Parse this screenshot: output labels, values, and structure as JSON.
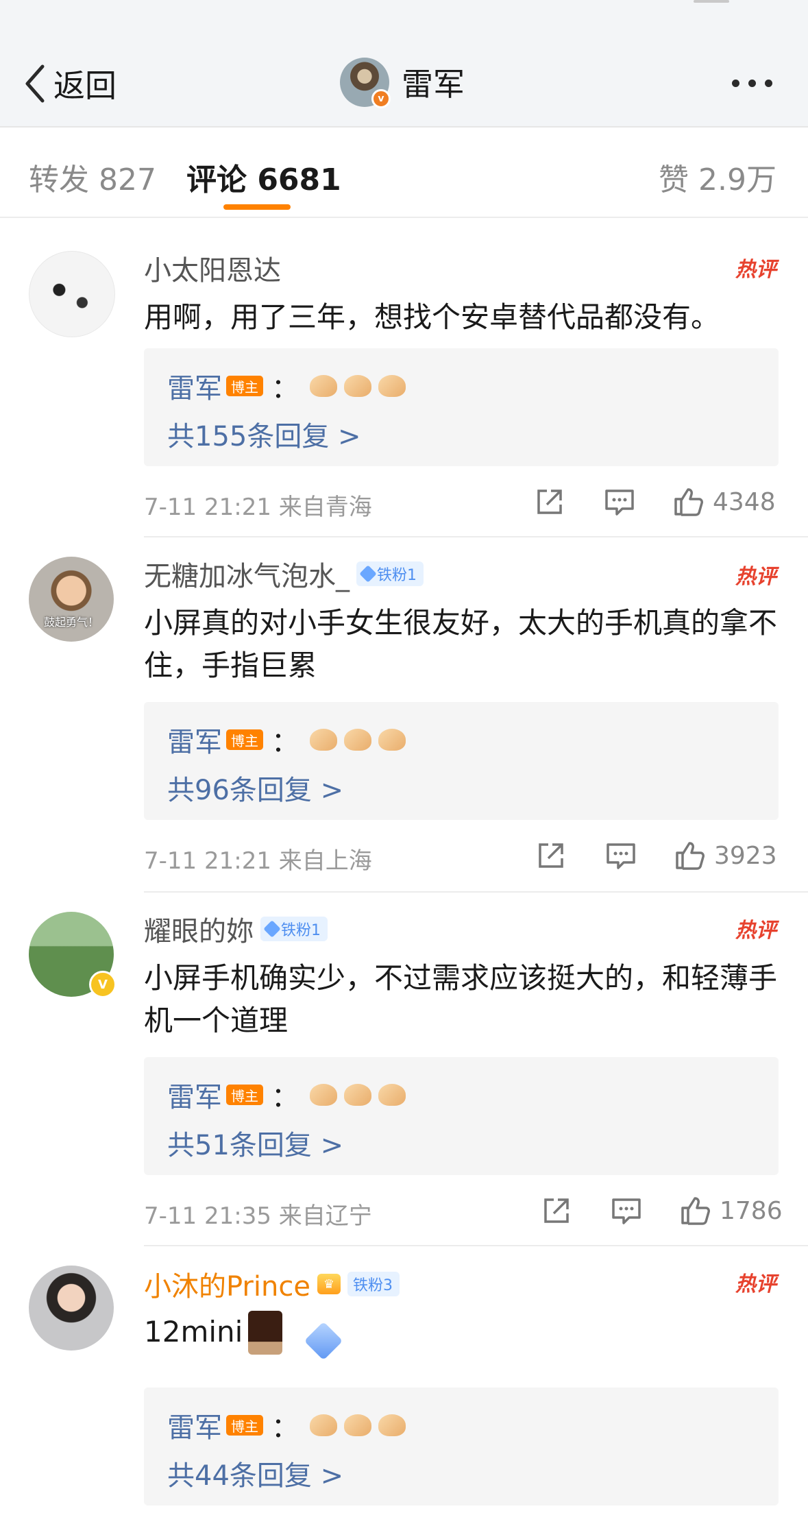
{
  "nav": {
    "back_label": "返回",
    "title": "雷军",
    "verified_mark": "v"
  },
  "tabs": {
    "repost": "转发 827",
    "comments": "评论 6681",
    "likes": "赞 2.9万"
  },
  "colors": {
    "accent": "#ff8200",
    "link_blue": "#4d6fa5",
    "hot": "#e7422e"
  },
  "comments": [
    {
      "user": "小太阳恩达",
      "hot_tag": "热评",
      "text": "用啊，用了三年，想找个安卓替代品都没有。",
      "reply": {
        "name": "雷军",
        "badge": "博主",
        "colon": "：",
        "more": "共155条回复 >"
      },
      "meta": "7-11 21:21 来自青海",
      "likes": "4348"
    },
    {
      "user": "无糖加冰气泡水_",
      "fan_badge": "铁粉1",
      "avatar_caption": "鼓起勇气！",
      "hot_tag": "热评",
      "text": "小屏真的对小手女生很友好，太大的手机真的拿不住，手指巨累",
      "reply": {
        "name": "雷军",
        "badge": "博主",
        "colon": "：",
        "more": "共96条回复 >"
      },
      "meta": "7-11 21:21 来自上海",
      "likes": "3923"
    },
    {
      "user": "耀眼的妳",
      "fan_badge": "铁粉1",
      "verified_mark": "V",
      "hot_tag": "热评",
      "text": "小屏手机确实少，不过需求应该挺大的，和轻薄手机一个道理",
      "reply": {
        "name": "雷军",
        "badge": "博主",
        "colon": "：",
        "more": "共51条回复 >"
      },
      "meta": "7-11 21:35 来自辽宁",
      "likes": "1786"
    },
    {
      "user": "小沐的Prince",
      "fan_badge": "铁粉3",
      "hot_tag": "热评",
      "text": "12mini",
      "reply": {
        "name": "雷军",
        "badge": "博主",
        "colon": "：",
        "more": "共44条回复 >"
      }
    }
  ]
}
